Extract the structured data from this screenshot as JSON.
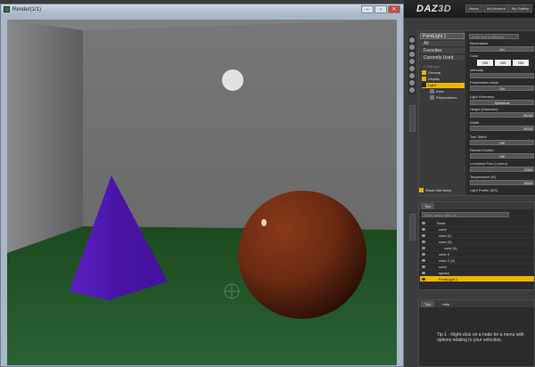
{
  "render_window": {
    "title": "Render(1/1)",
    "buttons": [
      "–",
      "▫",
      "✕"
    ]
  },
  "header": {
    "logo": "DAZ",
    "logo_suffix": "3D",
    "nav": [
      "Home",
      "My Account",
      "My Gallery"
    ]
  },
  "surfaces": {
    "node_select": "PointLight 1",
    "categories": [
      "All",
      "Favorites",
      "Currently Used"
    ],
    "tree": [
      {
        "label": "PointLight",
        "selected": false
      },
      {
        "label": "General",
        "selected": false
      },
      {
        "label": "Display",
        "selected": false
      },
      {
        "label": "Light",
        "selected": true
      },
      {
        "label": "Area",
        "selected": false
      },
      {
        "label": "Photometrics",
        "selected": false
      }
    ],
    "search_placeholder": "Enter text to filter by...",
    "properties": [
      {
        "label": "Illumination",
        "value": "On"
      },
      {
        "label": "Color",
        "value": ""
      },
      {
        "label": "Intensity",
        "value": ""
      },
      {
        "label": "Photometric Mode",
        "value": "On"
      },
      {
        "label": "Light Geometry",
        "value": "Spherical"
      },
      {
        "label": "Height (Diameter)",
        "value": "35.00"
      },
      {
        "label": "Width",
        "value": "35.00"
      },
      {
        "label": "Two Sided",
        "value": "Off"
      },
      {
        "label": "Render Emitter",
        "value": "Off"
      },
      {
        "label": "Luminous Flux (Lumen)",
        "value": "2000"
      },
      {
        "label": "Temperature (K)",
        "value": "6500"
      },
      {
        "label": "Light Profile (IES)",
        "value": ""
      }
    ],
    "color_values": [
      "255",
      "255",
      "255"
    ],
    "show_sub_items": "Show Sub Items"
  },
  "scene": {
    "tab": "Tips",
    "search_placeholder": "Enter text to filter by...",
    "nodes": [
      {
        "label": "Node",
        "selected": false
      },
      {
        "label": "cube",
        "selected": false
      },
      {
        "label": "cube (2)",
        "selected": false
      },
      {
        "label": "cube (3)",
        "selected": false
      },
      {
        "label": "cube (4)",
        "selected": false
      },
      {
        "label": "cube 2",
        "selected": false
      },
      {
        "label": "cube 2 (2)",
        "selected": false
      },
      {
        "label": "cone",
        "selected": false
      },
      {
        "label": "sphere",
        "selected": false
      },
      {
        "label": "PointLight 1",
        "selected": true
      }
    ]
  },
  "tips": {
    "tabs": [
      "Tips",
      "Help"
    ],
    "text": "Tip 1 - Right-click on a node for a menu with options relating to your selection."
  },
  "colors": {
    "accent": "#f0b400"
  }
}
